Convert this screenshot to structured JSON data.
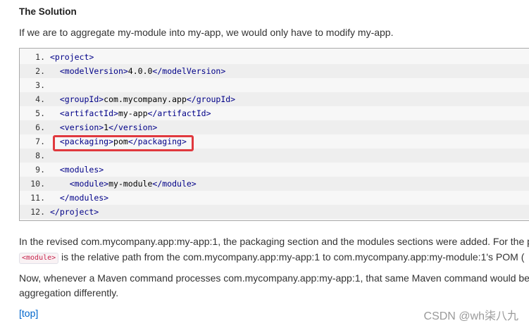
{
  "section": {
    "heading": "The Solution",
    "intro": "If we are to aggregate my-module into my-app, we would only have to modify my-app."
  },
  "code": {
    "lines": [
      {
        "num": "1.",
        "indent": "",
        "open": "<project>",
        "text": "",
        "close": ""
      },
      {
        "num": "2.",
        "indent": "  ",
        "open": "<modelVersion>",
        "text": "4.0.0",
        "close": "</modelVersion>"
      },
      {
        "num": "3.",
        "indent": "",
        "open": "",
        "text": "",
        "close": ""
      },
      {
        "num": "4.",
        "indent": "  ",
        "open": "<groupId>",
        "text": "com.mycompany.app",
        "close": "</groupId>"
      },
      {
        "num": "5.",
        "indent": "  ",
        "open": "<artifactId>",
        "text": "my-app",
        "close": "</artifactId>"
      },
      {
        "num": "6.",
        "indent": "  ",
        "open": "<version>",
        "text": "1",
        "close": "</version>"
      },
      {
        "num": "7.",
        "indent": "  ",
        "open": "<packaging>",
        "text": "pom",
        "close": "</packaging>"
      },
      {
        "num": "8.",
        "indent": "",
        "open": "",
        "text": "",
        "close": ""
      },
      {
        "num": "9.",
        "indent": "  ",
        "open": "<modules>",
        "text": "",
        "close": ""
      },
      {
        "num": "10.",
        "indent": "    ",
        "open": "<module>",
        "text": "my-module",
        "close": "</module>"
      },
      {
        "num": "11.",
        "indent": "  ",
        "open": "</modules>",
        "text": "",
        "close": ""
      },
      {
        "num": "12.",
        "indent": "",
        "open": "</project>",
        "text": "",
        "close": ""
      }
    ],
    "highlight_line": "7."
  },
  "paragraphs": {
    "p1_line1": "In the revised com.mycompany.app:my-app:1, the packaging section and the modules sections were added. For the p",
    "p1_code": "<module>",
    "p1_line2": " is the relative path from the com.mycompany.app:my-app:1 to com.mycompany.app:my-module:1's POM (",
    "p2_line1": "Now, whenever a Maven command processes com.mycompany.app:my-app:1, that same Maven command would be",
    "p2_line2": "aggregation differently."
  },
  "links": {
    "top": "[top]"
  },
  "watermark": "CSDN @wh柒八九",
  "colors": {
    "highlight_border": "#e0393e",
    "tag": "#000088",
    "link": "#0066cc",
    "inline_code": "#c7254e"
  }
}
